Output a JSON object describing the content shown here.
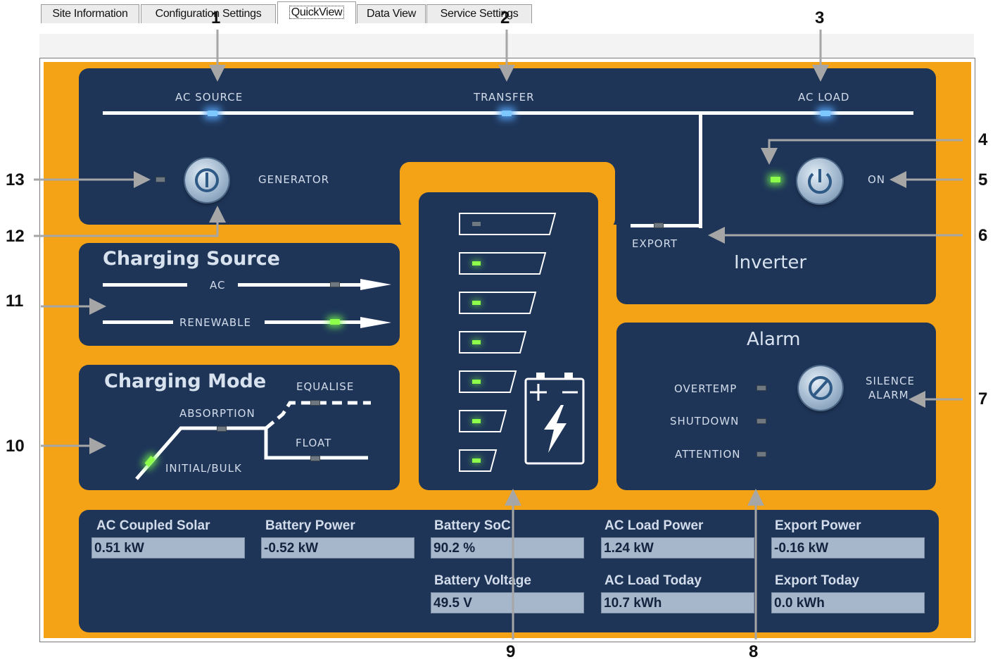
{
  "tabs": [
    {
      "label": "Site Information"
    },
    {
      "label": "Configuration Settings"
    },
    {
      "label": "QuickView"
    },
    {
      "label": "Data View"
    },
    {
      "label": "Service Settings"
    }
  ],
  "callouts": [
    "1",
    "2",
    "3",
    "4",
    "5",
    "6",
    "7",
    "8",
    "9",
    "10",
    "11",
    "12",
    "13"
  ],
  "power_flow": {
    "ac_source": "AC SOURCE",
    "transfer": "TRANSFER",
    "ac_load": "AC LOAD",
    "generator": "GENERATOR",
    "export": "EXPORT",
    "on": "ON",
    "inverter": "Inverter"
  },
  "charging_source": {
    "title": "Charging Source",
    "ac": "AC",
    "renewable": "RENEWABLE"
  },
  "charging_mode": {
    "title": "Charging Mode",
    "equalise": "EQUALISE",
    "absorption": "ABSORPTION",
    "float": "FLOAT",
    "initial_bulk": "INITIAL/BULK"
  },
  "battery_levels": {
    "total_segments": 7,
    "lit_segments": 6
  },
  "alarm": {
    "title": "Alarm",
    "overtemp": "OVERTEMP",
    "shutdown": "SHUTDOWN",
    "attention": "ATTENTION",
    "silence_line1": "SILENCE",
    "silence_line2": "ALARM"
  },
  "meters": {
    "ac_coupled_solar": {
      "label": "AC Coupled Solar",
      "value": "0.51 kW"
    },
    "battery_power": {
      "label": "Battery Power",
      "value": "-0.52 kW"
    },
    "battery_soc": {
      "label": "Battery SoC",
      "value": "90.2 %"
    },
    "ac_load_power": {
      "label": "AC Load Power",
      "value": "1.24 kW"
    },
    "export_power": {
      "label": "Export Power",
      "value": "-0.16 kW"
    },
    "battery_voltage": {
      "label": "Battery Voltage",
      "value": "49.5 V"
    },
    "ac_load_today": {
      "label": "AC Load Today",
      "value": "10.7 kWh"
    },
    "export_today": {
      "label": "Export Today",
      "value": "0.0 kWh"
    }
  },
  "colors": {
    "background": "#f4a316",
    "panel": "#1e3558",
    "led_green": "#8dff4a",
    "led_blue": "#7cc8ff"
  }
}
